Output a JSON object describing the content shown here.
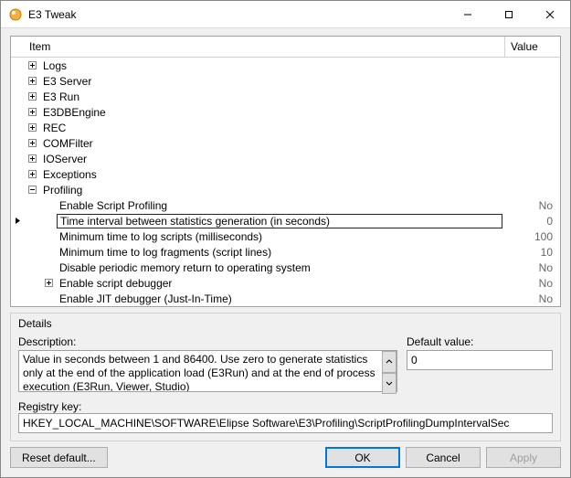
{
  "window": {
    "title": "E3 Tweak"
  },
  "columns": {
    "item": "Item",
    "value": "Value"
  },
  "tree": {
    "items": [
      {
        "label": "Logs",
        "expandable": true,
        "expanded": false,
        "level": 0,
        "value": ""
      },
      {
        "label": "E3 Server",
        "expandable": true,
        "expanded": false,
        "level": 0,
        "value": ""
      },
      {
        "label": "E3 Run",
        "expandable": true,
        "expanded": false,
        "level": 0,
        "value": ""
      },
      {
        "label": "E3DBEngine",
        "expandable": true,
        "expanded": false,
        "level": 0,
        "value": ""
      },
      {
        "label": "REC",
        "expandable": true,
        "expanded": false,
        "level": 0,
        "value": ""
      },
      {
        "label": "COMFilter",
        "expandable": true,
        "expanded": false,
        "level": 0,
        "value": ""
      },
      {
        "label": "IOServer",
        "expandable": true,
        "expanded": false,
        "level": 0,
        "value": ""
      },
      {
        "label": "Exceptions",
        "expandable": true,
        "expanded": false,
        "level": 0,
        "value": ""
      },
      {
        "label": "Profiling",
        "expandable": true,
        "expanded": true,
        "level": 0,
        "value": ""
      },
      {
        "label": "Enable Script Profiling",
        "expandable": false,
        "level": 1,
        "value": "No"
      },
      {
        "label": "Time interval between statistics generation (in seconds)",
        "expandable": false,
        "level": 1,
        "value": "0",
        "selected": true
      },
      {
        "label": "Minimum time to log scripts (milliseconds)",
        "expandable": false,
        "level": 1,
        "value": "100"
      },
      {
        "label": "Minimum time to log fragments (script lines)",
        "expandable": false,
        "level": 1,
        "value": "10"
      },
      {
        "label": "Disable periodic memory return to operating system",
        "expandable": false,
        "level": 1,
        "value": "No"
      },
      {
        "label": "Enable script debugger",
        "expandable": true,
        "expanded": false,
        "level": 1,
        "value": "No"
      },
      {
        "label": "Enable JIT debugger (Just-In-Time)",
        "expandable": false,
        "level": 1,
        "value": "No"
      }
    ]
  },
  "details": {
    "groupTitle": "Details",
    "descLabel": "Description:",
    "descValue": "Value in seconds between 1 and 86400. Use zero to generate statistics only at the end of the application load (E3Run) and at the end of process execution (E3Run, Viewer, Studio)",
    "defaultLabel": "Default value:",
    "defaultValue": "0",
    "regLabel": "Registry key:",
    "regValue": "HKEY_LOCAL_MACHINE\\SOFTWARE\\Elipse Software\\E3\\Profiling\\ScriptProfilingDumpIntervalSec"
  },
  "buttons": {
    "reset": "Reset default...",
    "ok": "OK",
    "cancel": "Cancel",
    "apply": "Apply"
  }
}
